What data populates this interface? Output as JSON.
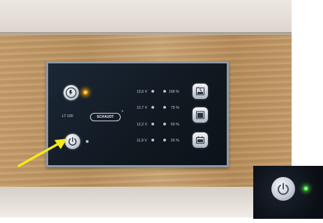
{
  "panel": {
    "model": "LT 100",
    "brand": "SCHAUDT",
    "registered_mark": "®",
    "levels": [
      {
        "voltage": "13,5 V",
        "percent": "100 %"
      },
      {
        "voltage": "12,7 V",
        "percent": "75 %"
      },
      {
        "voltage": "12,2 V",
        "percent": "50 %"
      },
      {
        "voltage": "11,9 V",
        "percent": "25 %"
      }
    ]
  },
  "icons": {
    "pump": "pump-icon",
    "power": "power-icon",
    "fresh_water": "fresh-water-tank-icon",
    "grey_water": "grey-water-tank-icon",
    "battery": "battery-icon"
  },
  "colors": {
    "pump_led": "#f0a400",
    "inset_led": "#3fdb3a",
    "arrow": "#f2ea1a"
  }
}
